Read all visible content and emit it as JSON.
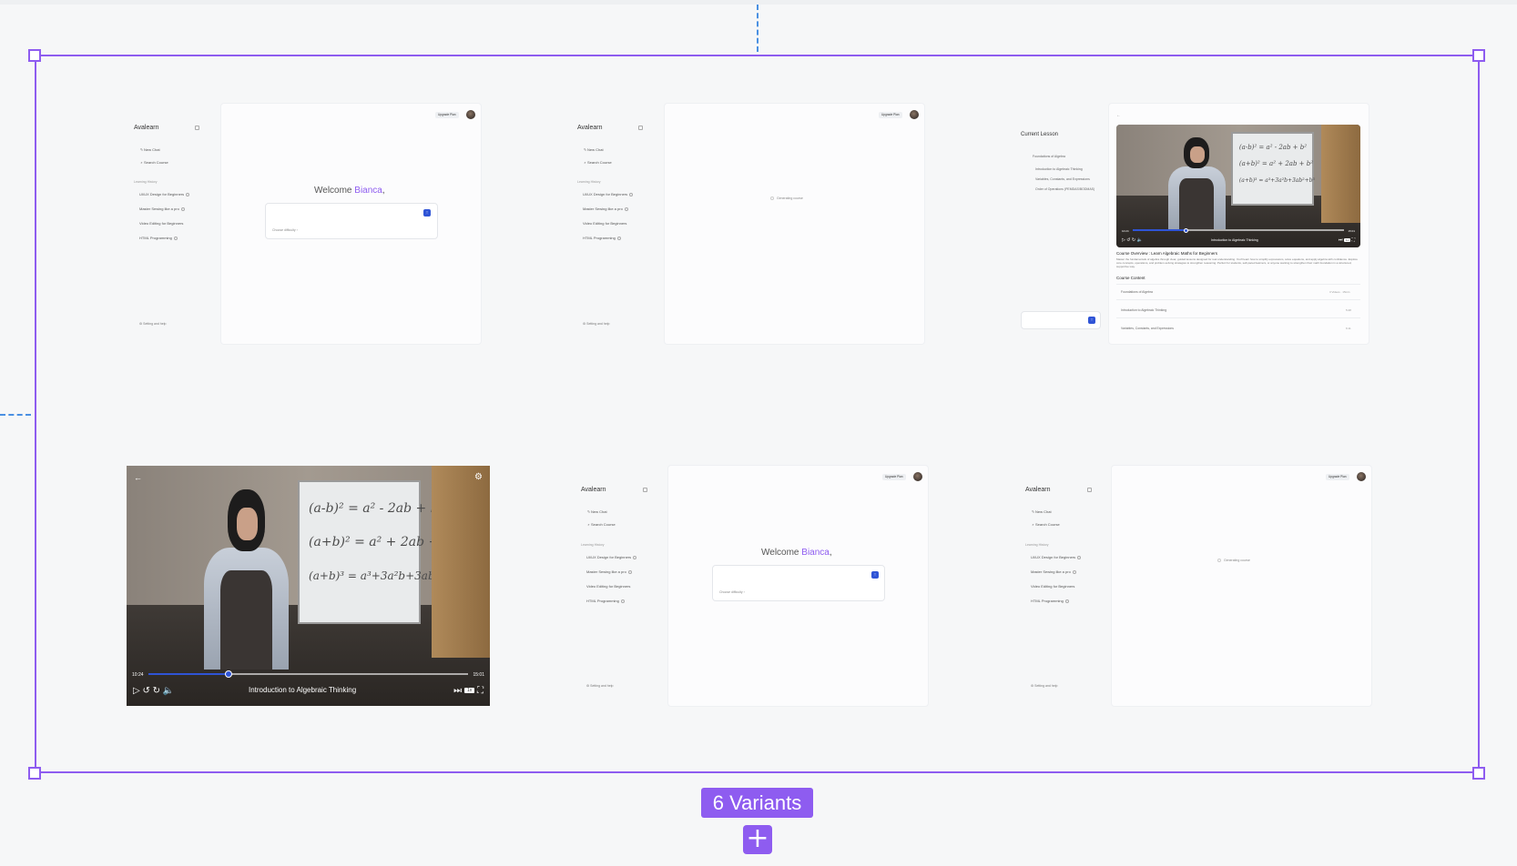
{
  "app": {
    "brand": "Avalearn",
    "user_name": "Bianca",
    "welcome_prefix": "Welcome ",
    "welcome_suffix": ",",
    "upgrade_label": "Upgrade Plan",
    "new_chat": "New Chat",
    "search_course": "Search Course",
    "learning_history": "Learning History",
    "history": [
      "UI/UX Design for Beginners",
      "Master Sewing like a pro",
      "Video Editing for Beginners",
      "HTML Programming"
    ],
    "settings": "Setting and help",
    "choose_difficulty": "Choose difficulty",
    "generating": "Generating course"
  },
  "lesson": {
    "current_lesson": "Current Lesson",
    "outline": [
      "Foundations of Algebra",
      "Introduction to Algebraic Thinking",
      "Variables, Constants, and Expressions",
      "Order of Operations (PEMDAS/BODMAS)"
    ],
    "course_title": "Course Overview : Learn Algebraic Maths for Beginners",
    "course_desc": "Master the fundamentals of algebra through clear, guided lessons designed for real understanding. You'll learn how to simplify expressions, solve equations, and apply algebra with confidence. Explore core concepts, operations, and problem-solving strategies to strengthen reasoning. Perfect for students, self-paced learners, or anyone wanting to strengthen their math foundation in a structured, supportive way.",
    "course_content": "Course Content",
    "rows": [
      {
        "label": "Foundations of Algebra",
        "meta": "3 Videos · 15min"
      },
      {
        "label": "Introduction to Algebraic Thinking",
        "meta": "5:28"
      },
      {
        "label": "Variables, Constants, and Expressions",
        "meta": "6:11"
      }
    ]
  },
  "video": {
    "title": "Introduction to Algebraic Thinking",
    "time_current": "10:24",
    "time_total": "15:01",
    "progress": 0.25,
    "speed": "1x",
    "equations": [
      "(a-b)² = a² - 2ab + b²",
      "(a+b)² = a² + 2ab + b²",
      "(a+b)³ = a³+3a²b+3ab²+b³"
    ]
  },
  "canvas": {
    "variants_label": "6 Variants",
    "add_symbol": "+"
  },
  "icons": {
    "chat": "✎",
    "search": "⌕",
    "settings": "⚙",
    "send": "↑",
    "play": "▷",
    "rewind": "↺",
    "forward": "↻",
    "volume": "🔈",
    "next": "⏭",
    "back": "←",
    "fullscreen": "⛶",
    "chevron": "›"
  },
  "colors": {
    "accent": "#8e5cf0",
    "primary": "#2f54d6",
    "guide": "#4a90e2"
  }
}
